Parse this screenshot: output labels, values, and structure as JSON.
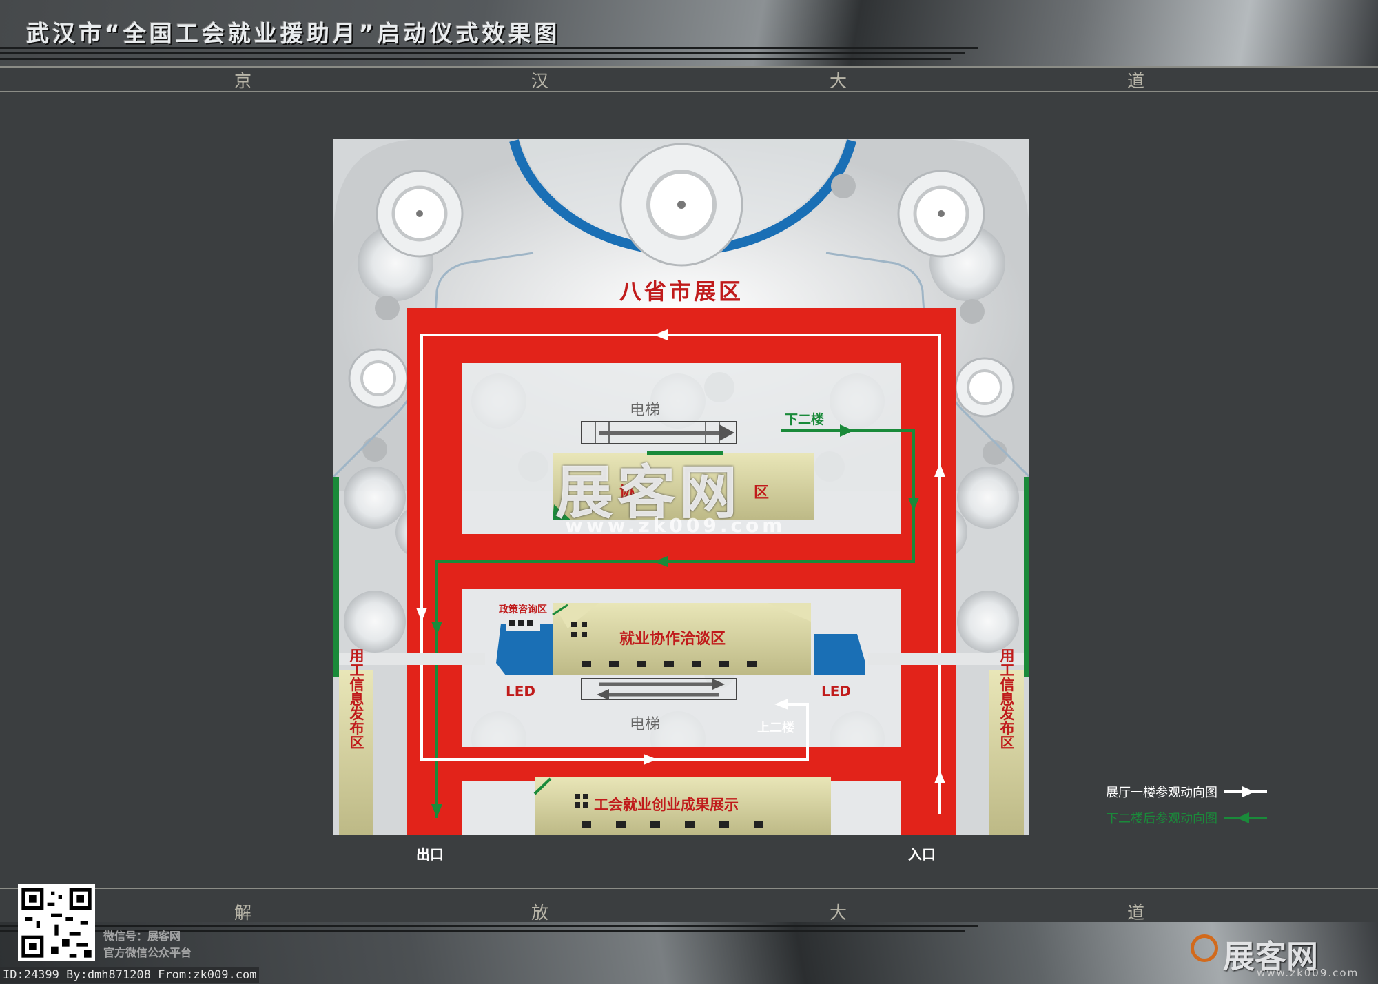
{
  "header": {
    "title": "武汉市“全国工会就业援助月”启动仪式效果图"
  },
  "roads": {
    "top": [
      "京",
      "汉",
      "大",
      "道"
    ],
    "bottom": [
      "解",
      "放",
      "大",
      "道"
    ]
  },
  "zones": {
    "provinces": "八省市展区",
    "elevator_top": "电梯",
    "elevator_bottom": "电梯",
    "down_second_floor": "下二楼",
    "up_second_floor": "上二楼",
    "policy": "政策咨询区",
    "negotiation": "就业协作洽谈区",
    "upper_zone_partial": "协",
    "upper_zone_partial_right": "区",
    "achievements": "工会就业创业成果展示",
    "led_left": "LED",
    "led_right": "LED",
    "info_left": "用工信息发布区",
    "info_right": "用工信息发布区",
    "exit": "出口",
    "entrance": "入口"
  },
  "legend": {
    "first_floor": "展厅一楼参观动向图",
    "after_second_floor": "下二楼后参观动向图",
    "white_color": "#ffffff",
    "green_color": "#1a8a3a"
  },
  "colors": {
    "red_route": "#e2231a",
    "green_route": "#1a8a3a",
    "blue_arc": "#1a6fb5",
    "background": "#3b3e40"
  },
  "watermark": {
    "text": "展客网",
    "url": "www.zk009.com"
  },
  "footer": {
    "wechat_line1": "微信号：展客网",
    "wechat_line2": "官方微信公众平台",
    "brand": "展客网",
    "brand_url": "www.zk009.com",
    "id_line": "ID:24399 By:dmh871208 From:zk009.com"
  }
}
